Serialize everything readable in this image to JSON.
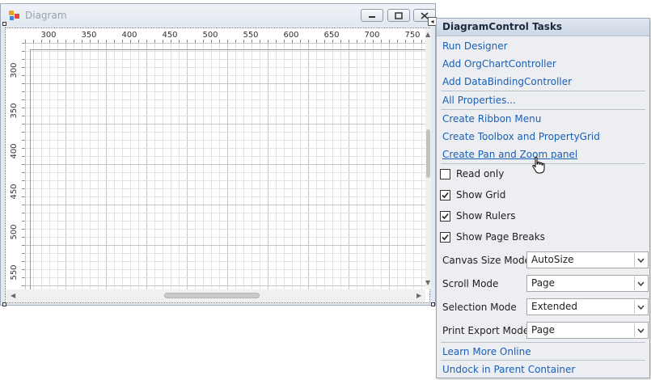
{
  "window": {
    "title": "Diagram",
    "ruler_top_ticks": [
      "300",
      "350",
      "400",
      "450",
      "500",
      "550",
      "600",
      "650",
      "700",
      "750"
    ],
    "ruler_left_ticks": [
      "300",
      "350",
      "400",
      "450",
      "500",
      "550"
    ]
  },
  "tasks": {
    "header": "DiagramControl Tasks",
    "links_top": [
      "Run Designer",
      "Add OrgChartController",
      "Add DataBindingController"
    ],
    "all_properties": "All Properties...",
    "links_create": [
      "Create Ribbon Menu",
      "Create Toolbox and PropertyGrid",
      "Create Pan and Zoom panel"
    ],
    "checkboxes": [
      {
        "label": "Read only",
        "checked": false
      },
      {
        "label": "Show Grid",
        "checked": true
      },
      {
        "label": "Show Rulers",
        "checked": true
      },
      {
        "label": "Show Page Breaks",
        "checked": true
      }
    ],
    "fields": [
      {
        "label": "Canvas Size Mode",
        "value": "AutoSize"
      },
      {
        "label": "Scroll Mode",
        "value": "Page"
      },
      {
        "label": "Selection Mode",
        "value": "Extended"
      },
      {
        "label": "Print Export Mode",
        "value": "Page"
      }
    ],
    "learn_more": "Learn More Online",
    "undock": "Undock in Parent Container"
  },
  "colors": {
    "link": "#1a5fb4",
    "header_bg": "#cdd7e5"
  }
}
